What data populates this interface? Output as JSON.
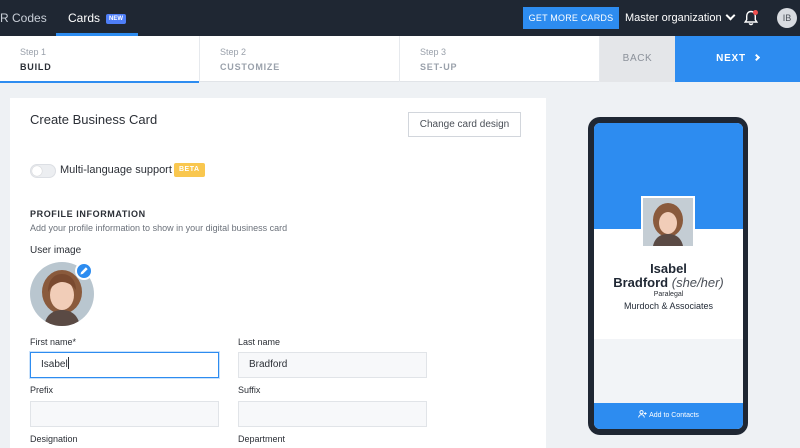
{
  "nav": {
    "qr_tab": "R Codes",
    "cards_tab": "Cards",
    "new_badge": "NEW",
    "get_more_button": "GET MORE CARDS",
    "organization": "Master organization",
    "avatar_initials": "IB"
  },
  "stepper": {
    "steps": [
      {
        "number": "Step 1",
        "label": "BUILD"
      },
      {
        "number": "Step 2",
        "label": "CUSTOMIZE"
      },
      {
        "number": "Step 3",
        "label": "SET-UP"
      }
    ],
    "back_label": "BACK",
    "next_label": "NEXT"
  },
  "form": {
    "title": "Create Business Card",
    "change_design_label": "Change card design",
    "multi_language_label": "Multi-language support",
    "beta_badge": "BETA",
    "section_title": "PROFILE INFORMATION",
    "section_subtitle": "Add your profile information to show in your digital business card",
    "user_image_label": "User image",
    "fields": {
      "first_name": {
        "label": "First name*",
        "value": "Isabel"
      },
      "last_name": {
        "label": "Last name",
        "value": "Bradford"
      },
      "prefix": {
        "label": "Prefix",
        "value": ""
      },
      "suffix": {
        "label": "Suffix",
        "value": ""
      },
      "designation": {
        "label": "Designation"
      },
      "department": {
        "label": "Department"
      }
    }
  },
  "preview": {
    "first_name": "Isabel",
    "last_name": "Bradford",
    "pronouns": "(she/her)",
    "role": "Paralegal",
    "company": "Murdoch & Associates",
    "add_contacts_label": "Add to Contacts"
  },
  "colors": {
    "accent": "#2d8cf0",
    "nav_bg": "#1f2733",
    "beta": "#f9c74f"
  }
}
